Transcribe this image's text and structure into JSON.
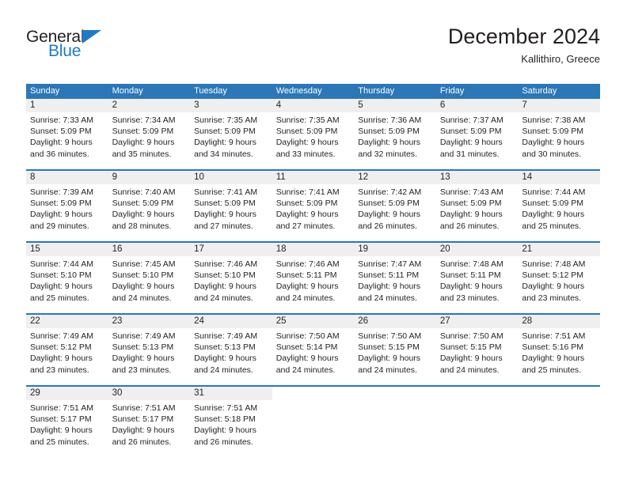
{
  "brand": {
    "name_top": "General",
    "name_bottom": "Blue",
    "accent_color": "#1f7ac4"
  },
  "header": {
    "title": "December 2024",
    "subtitle": "Kallithiro, Greece"
  },
  "theme": {
    "header_bar_color": "#2b77b8",
    "day_number_band_color": "#efefef",
    "text_color": "#231f20",
    "page_background": "#ffffff"
  },
  "weekday_headers": [
    "Sunday",
    "Monday",
    "Tuesday",
    "Wednesday",
    "Thursday",
    "Friday",
    "Saturday"
  ],
  "weeks": [
    {
      "days": [
        {
          "num": "1",
          "sunrise": "Sunrise: 7:33 AM",
          "sunset": "Sunset: 5:09 PM",
          "daylight1": "Daylight: 9 hours",
          "daylight2": "and 36 minutes."
        },
        {
          "num": "2",
          "sunrise": "Sunrise: 7:34 AM",
          "sunset": "Sunset: 5:09 PM",
          "daylight1": "Daylight: 9 hours",
          "daylight2": "and 35 minutes."
        },
        {
          "num": "3",
          "sunrise": "Sunrise: 7:35 AM",
          "sunset": "Sunset: 5:09 PM",
          "daylight1": "Daylight: 9 hours",
          "daylight2": "and 34 minutes."
        },
        {
          "num": "4",
          "sunrise": "Sunrise: 7:35 AM",
          "sunset": "Sunset: 5:09 PM",
          "daylight1": "Daylight: 9 hours",
          "daylight2": "and 33 minutes."
        },
        {
          "num": "5",
          "sunrise": "Sunrise: 7:36 AM",
          "sunset": "Sunset: 5:09 PM",
          "daylight1": "Daylight: 9 hours",
          "daylight2": "and 32 minutes."
        },
        {
          "num": "6",
          "sunrise": "Sunrise: 7:37 AM",
          "sunset": "Sunset: 5:09 PM",
          "daylight1": "Daylight: 9 hours",
          "daylight2": "and 31 minutes."
        },
        {
          "num": "7",
          "sunrise": "Sunrise: 7:38 AM",
          "sunset": "Sunset: 5:09 PM",
          "daylight1": "Daylight: 9 hours",
          "daylight2": "and 30 minutes."
        }
      ]
    },
    {
      "days": [
        {
          "num": "8",
          "sunrise": "Sunrise: 7:39 AM",
          "sunset": "Sunset: 5:09 PM",
          "daylight1": "Daylight: 9 hours",
          "daylight2": "and 29 minutes."
        },
        {
          "num": "9",
          "sunrise": "Sunrise: 7:40 AM",
          "sunset": "Sunset: 5:09 PM",
          "daylight1": "Daylight: 9 hours",
          "daylight2": "and 28 minutes."
        },
        {
          "num": "10",
          "sunrise": "Sunrise: 7:41 AM",
          "sunset": "Sunset: 5:09 PM",
          "daylight1": "Daylight: 9 hours",
          "daylight2": "and 27 minutes."
        },
        {
          "num": "11",
          "sunrise": "Sunrise: 7:41 AM",
          "sunset": "Sunset: 5:09 PM",
          "daylight1": "Daylight: 9 hours",
          "daylight2": "and 27 minutes."
        },
        {
          "num": "12",
          "sunrise": "Sunrise: 7:42 AM",
          "sunset": "Sunset: 5:09 PM",
          "daylight1": "Daylight: 9 hours",
          "daylight2": "and 26 minutes."
        },
        {
          "num": "13",
          "sunrise": "Sunrise: 7:43 AM",
          "sunset": "Sunset: 5:09 PM",
          "daylight1": "Daylight: 9 hours",
          "daylight2": "and 26 minutes."
        },
        {
          "num": "14",
          "sunrise": "Sunrise: 7:44 AM",
          "sunset": "Sunset: 5:09 PM",
          "daylight1": "Daylight: 9 hours",
          "daylight2": "and 25 minutes."
        }
      ]
    },
    {
      "days": [
        {
          "num": "15",
          "sunrise": "Sunrise: 7:44 AM",
          "sunset": "Sunset: 5:10 PM",
          "daylight1": "Daylight: 9 hours",
          "daylight2": "and 25 minutes."
        },
        {
          "num": "16",
          "sunrise": "Sunrise: 7:45 AM",
          "sunset": "Sunset: 5:10 PM",
          "daylight1": "Daylight: 9 hours",
          "daylight2": "and 24 minutes."
        },
        {
          "num": "17",
          "sunrise": "Sunrise: 7:46 AM",
          "sunset": "Sunset: 5:10 PM",
          "daylight1": "Daylight: 9 hours",
          "daylight2": "and 24 minutes."
        },
        {
          "num": "18",
          "sunrise": "Sunrise: 7:46 AM",
          "sunset": "Sunset: 5:11 PM",
          "daylight1": "Daylight: 9 hours",
          "daylight2": "and 24 minutes."
        },
        {
          "num": "19",
          "sunrise": "Sunrise: 7:47 AM",
          "sunset": "Sunset: 5:11 PM",
          "daylight1": "Daylight: 9 hours",
          "daylight2": "and 24 minutes."
        },
        {
          "num": "20",
          "sunrise": "Sunrise: 7:48 AM",
          "sunset": "Sunset: 5:11 PM",
          "daylight1": "Daylight: 9 hours",
          "daylight2": "and 23 minutes."
        },
        {
          "num": "21",
          "sunrise": "Sunrise: 7:48 AM",
          "sunset": "Sunset: 5:12 PM",
          "daylight1": "Daylight: 9 hours",
          "daylight2": "and 23 minutes."
        }
      ]
    },
    {
      "days": [
        {
          "num": "22",
          "sunrise": "Sunrise: 7:49 AM",
          "sunset": "Sunset: 5:12 PM",
          "daylight1": "Daylight: 9 hours",
          "daylight2": "and 23 minutes."
        },
        {
          "num": "23",
          "sunrise": "Sunrise: 7:49 AM",
          "sunset": "Sunset: 5:13 PM",
          "daylight1": "Daylight: 9 hours",
          "daylight2": "and 23 minutes."
        },
        {
          "num": "24",
          "sunrise": "Sunrise: 7:49 AM",
          "sunset": "Sunset: 5:13 PM",
          "daylight1": "Daylight: 9 hours",
          "daylight2": "and 24 minutes."
        },
        {
          "num": "25",
          "sunrise": "Sunrise: 7:50 AM",
          "sunset": "Sunset: 5:14 PM",
          "daylight1": "Daylight: 9 hours",
          "daylight2": "and 24 minutes."
        },
        {
          "num": "26",
          "sunrise": "Sunrise: 7:50 AM",
          "sunset": "Sunset: 5:15 PM",
          "daylight1": "Daylight: 9 hours",
          "daylight2": "and 24 minutes."
        },
        {
          "num": "27",
          "sunrise": "Sunrise: 7:50 AM",
          "sunset": "Sunset: 5:15 PM",
          "daylight1": "Daylight: 9 hours",
          "daylight2": "and 24 minutes."
        },
        {
          "num": "28",
          "sunrise": "Sunrise: 7:51 AM",
          "sunset": "Sunset: 5:16 PM",
          "daylight1": "Daylight: 9 hours",
          "daylight2": "and 25 minutes."
        }
      ]
    },
    {
      "days": [
        {
          "num": "29",
          "sunrise": "Sunrise: 7:51 AM",
          "sunset": "Sunset: 5:17 PM",
          "daylight1": "Daylight: 9 hours",
          "daylight2": "and 25 minutes."
        },
        {
          "num": "30",
          "sunrise": "Sunrise: 7:51 AM",
          "sunset": "Sunset: 5:17 PM",
          "daylight1": "Daylight: 9 hours",
          "daylight2": "and 26 minutes."
        },
        {
          "num": "31",
          "sunrise": "Sunrise: 7:51 AM",
          "sunset": "Sunset: 5:18 PM",
          "daylight1": "Daylight: 9 hours",
          "daylight2": "and 26 minutes."
        },
        {
          "num": "",
          "sunrise": "",
          "sunset": "",
          "daylight1": "",
          "daylight2": ""
        },
        {
          "num": "",
          "sunrise": "",
          "sunset": "",
          "daylight1": "",
          "daylight2": ""
        },
        {
          "num": "",
          "sunrise": "",
          "sunset": "",
          "daylight1": "",
          "daylight2": ""
        },
        {
          "num": "",
          "sunrise": "",
          "sunset": "",
          "daylight1": "",
          "daylight2": ""
        }
      ]
    }
  ]
}
